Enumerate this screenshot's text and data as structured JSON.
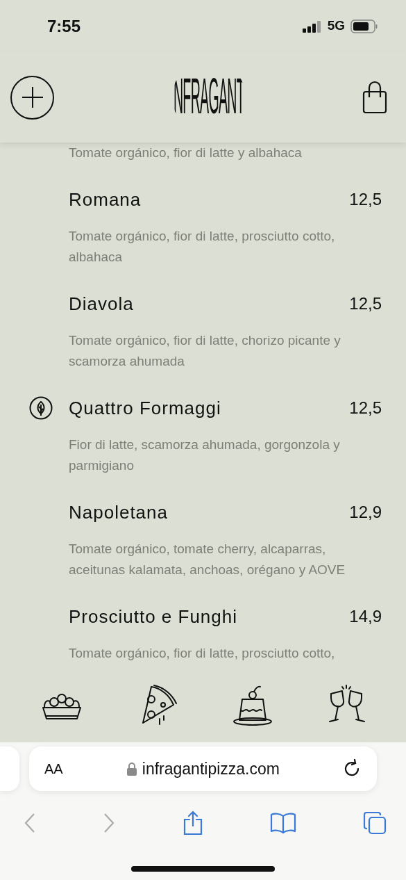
{
  "status_bar": {
    "time": "7:55",
    "network": "5G"
  },
  "header": {
    "logo_text": "NFRAGANT"
  },
  "menu": {
    "lead_description": "Tomate orgánico, fior di latte y albahaca",
    "items": [
      {
        "name": "Romana",
        "price": "12,5",
        "description": "Tomate orgánico, fior di latte, prosciutto cotto, albahaca",
        "vegetarian": false
      },
      {
        "name": "Diavola",
        "price": "12,5",
        "description": "Tomate orgánico, fior di latte, chorizo picante y scamorza ahumada",
        "vegetarian": false
      },
      {
        "name": "Quattro Formaggi",
        "price": "12,5",
        "description": "Fior di latte, scamorza ahumada, gorgonzola y parmigiano",
        "vegetarian": true
      },
      {
        "name": "Napoletana",
        "price": "12,9",
        "description": "Tomate orgánico, tomate cherry, alcaparras, aceitunas kalamata, anchoas, orégano y AOVE",
        "vegetarian": false
      },
      {
        "name": "Prosciutto e Funghi",
        "price": "14,9",
        "description": "Tomate orgánico, fior di latte, prosciutto cotto,",
        "vegetarian": false
      }
    ]
  },
  "category_bar": [
    {
      "kind": "salad"
    },
    {
      "kind": "pizza"
    },
    {
      "kind": "dessert"
    },
    {
      "kind": "drinks"
    }
  ],
  "browser": {
    "text_size_label": "AA",
    "url": "infragantipizza.com"
  }
}
